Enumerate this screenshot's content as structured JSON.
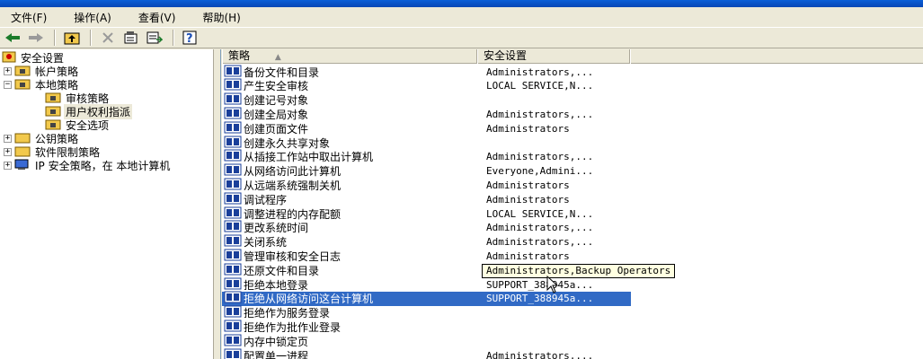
{
  "menu": [
    "文件(F)",
    "操作(A)",
    "查看(V)",
    "帮助(H)"
  ],
  "tree": {
    "root": "安全设置",
    "account_policies": "帐户策略",
    "local_policies": "本地策略",
    "audit_policy": "审核策略",
    "user_rights": "用户权利指派",
    "security_options": "安全选项",
    "public_key": "公钥策略",
    "software_restriction": "软件限制策略",
    "ip_security": "IP 安全策略，在 本地计算机"
  },
  "columns": {
    "policy": "策略",
    "setting": "安全设置"
  },
  "rows": [
    {
      "name": "备份文件和目录",
      "value": "Administrators,..."
    },
    {
      "name": "产生安全审核",
      "value": "LOCAL SERVICE,N..."
    },
    {
      "name": "创建记号对象",
      "value": ""
    },
    {
      "name": "创建全局对象",
      "value": "Administrators,..."
    },
    {
      "name": "创建页面文件",
      "value": "Administrators"
    },
    {
      "name": "创建永久共享对象",
      "value": ""
    },
    {
      "name": "从插接工作站中取出计算机",
      "value": "Administrators,..."
    },
    {
      "name": "从网络访问此计算机",
      "value": "Everyone,Admini..."
    },
    {
      "name": "从远端系统强制关机",
      "value": "Administrators"
    },
    {
      "name": "调试程序",
      "value": "Administrators"
    },
    {
      "name": "调整进程的内存配额",
      "value": "LOCAL SERVICE,N..."
    },
    {
      "name": "更改系统时间",
      "value": "Administrators,..."
    },
    {
      "name": "关闭系统",
      "value": "Administrators,..."
    },
    {
      "name": "管理审核和安全日志",
      "value": "Administrators"
    },
    {
      "name": "还原文件和目录",
      "value": ""
    },
    {
      "name": "拒绝本地登录",
      "value": "SUPPORT_388945a..."
    },
    {
      "name": "拒绝从网络访问这台计算机",
      "value": "SUPPORT_388945a..."
    },
    {
      "name": "拒绝作为服务登录",
      "value": ""
    },
    {
      "name": "拒绝作为批作业登录",
      "value": ""
    },
    {
      "name": "内存中锁定页",
      "value": ""
    },
    {
      "name": "配置单一进程",
      "value": "Administrators,..."
    }
  ],
  "tooltip": "Administrators,Backup Operators",
  "colors": {
    "selection": "#316ac5",
    "folder": "#f2c94c"
  }
}
